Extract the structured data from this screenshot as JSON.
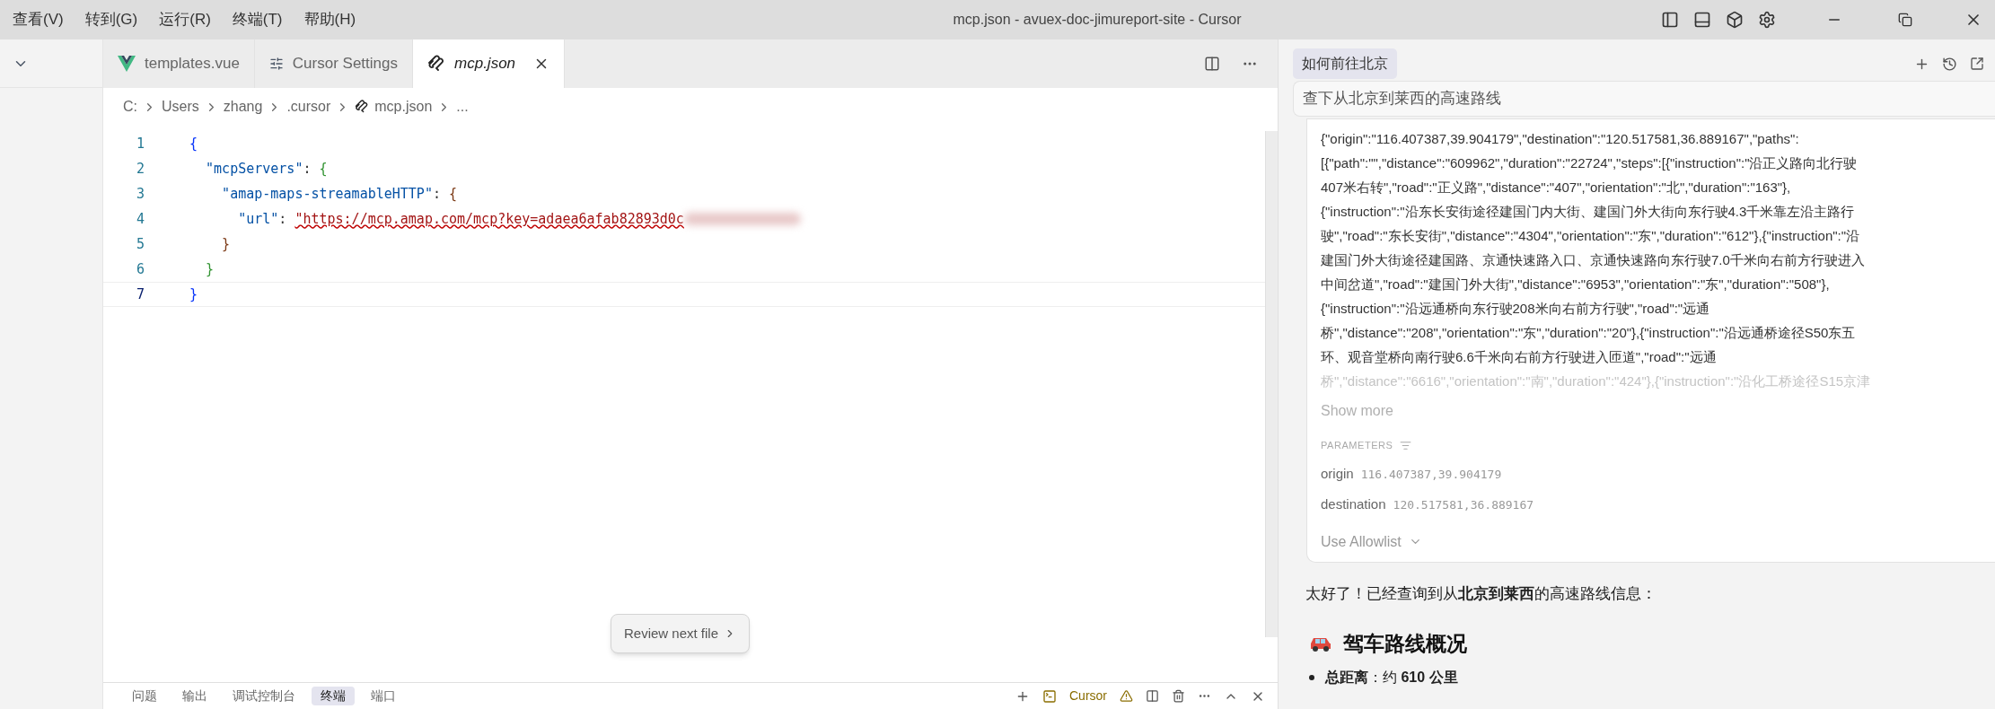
{
  "menu": [
    "查看(V)",
    "转到(G)",
    "运行(R)",
    "终端(T)",
    "帮助(H)"
  ],
  "window": {
    "title": "mcp.json - avuex-doc-jimureport-site - Cursor"
  },
  "tabs": [
    {
      "label": "templates.vue",
      "kind": "vue",
      "selected": false,
      "preview": false
    },
    {
      "label": "Cursor Settings",
      "kind": "settings",
      "selected": false,
      "preview": false
    },
    {
      "label": "mcp.json",
      "kind": "mcp",
      "selected": true,
      "preview": true
    }
  ],
  "breadcrumb": [
    "C:",
    "Users",
    "zhang",
    ".cursor",
    "mcp.json",
    "..."
  ],
  "code": [
    {
      "number": "1",
      "current": false,
      "tokens": [
        {
          "text": "{",
          "kind": "bracket",
          "color": "#0431fa"
        }
      ]
    },
    {
      "number": "2",
      "current": false,
      "tokens": [
        {
          "text": "  \"mcpServers\"",
          "kind": "key"
        },
        {
          "text": ": ",
          "kind": "punct"
        },
        {
          "text": "{",
          "kind": "bracket",
          "color": "#319331"
        }
      ]
    },
    {
      "number": "3",
      "current": false,
      "tokens": [
        {
          "text": "    \"amap-maps-streamableHTTP\"",
          "kind": "key"
        },
        {
          "text": ": ",
          "kind": "punct"
        },
        {
          "text": "{",
          "kind": "bracket",
          "color": "#7b3814"
        }
      ]
    },
    {
      "number": "4",
      "current": false,
      "tokens": [
        {
          "text": "      \"url\"",
          "kind": "key"
        },
        {
          "text": ": ",
          "kind": "punct"
        },
        {
          "text": "\"https://mcp.amap.com/mcp?key=adaea6afab82893d0c",
          "kind": "string"
        },
        {
          "kind": "redacted"
        }
      ]
    },
    {
      "number": "5",
      "current": false,
      "tokens": [
        {
          "text": "    }",
          "kind": "bracket",
          "color": "#7b3814"
        }
      ]
    },
    {
      "number": "6",
      "current": false,
      "tokens": [
        {
          "text": "  }",
          "kind": "bracket",
          "color": "#319331"
        }
      ]
    },
    {
      "number": "7",
      "current": true,
      "tokens": [
        {
          "text": "}",
          "kind": "bracket",
          "color": "#0431fa"
        }
      ]
    }
  ],
  "review_button": "Review next file",
  "panel_tabs": [
    {
      "label": "问题",
      "selected": false
    },
    {
      "label": "输出",
      "selected": false
    },
    {
      "label": "调试控制台",
      "selected": false
    },
    {
      "label": "终端",
      "selected": true
    },
    {
      "label": "端口",
      "selected": false
    }
  ],
  "terminal_name": "Cursor",
  "chat": {
    "title": "如何前往北京",
    "query": "查下从北京到莱西的高速路线",
    "result_lines": [
      {
        "text": "{\"origin\":\"116.407387,39.904179\",\"destination\":\"120.517581,36.889167\",\"paths\":",
        "faded": false
      },
      {
        "text": "[{\"path\":\"\",\"distance\":\"609962\",\"duration\":\"22724\",\"steps\":[{\"instruction\":\"沿正义路向北行驶",
        "faded": false
      },
      {
        "text": "407米右转\",\"road\":\"正义路\",\"distance\":\"407\",\"orientation\":\"北\",\"duration\":\"163\"},",
        "faded": false
      },
      {
        "text": "{\"instruction\":\"沿东长安街途径建国门内大街、建国门外大街向东行驶4.3千米靠左沿主路行",
        "faded": false
      },
      {
        "text": "驶\",\"road\":\"东长安街\",\"distance\":\"4304\",\"orientation\":\"东\",\"duration\":\"612\"},{\"instruction\":\"沿",
        "faded": false
      },
      {
        "text": "建国门外大街途径建国路、京通快速路入口、京通快速路向东行驶7.0千米向右前方行驶进入",
        "faded": false
      },
      {
        "text": "中间岔道\",\"road\":\"建国门外大街\",\"distance\":\"6953\",\"orientation\":\"东\",\"duration\":\"508\"},",
        "faded": false
      },
      {
        "text": "{\"instruction\":\"沿远通桥向东行驶208米向右前方行驶\",\"road\":\"远通",
        "faded": false
      },
      {
        "text": "桥\",\"distance\":\"208\",\"orientation\":\"东\",\"duration\":\"20\"},{\"instruction\":\"沿远通桥途径S50东五",
        "faded": false
      },
      {
        "text": "环、观音堂桥向南行驶6.6千米向右前方行驶进入匝道\",\"road\":\"远通",
        "faded": false
      },
      {
        "text": "桥\",\"distance\":\"6616\",\"orientation\":\"南\",\"duration\":\"424\"},{\"instruction\":\"沿化工桥途径S15京津",
        "faded": true
      }
    ],
    "show_more": "Show more",
    "parameters_label": "PARAMETERS",
    "parameters": [
      {
        "name": "origin",
        "value": "116.407387,39.904179"
      },
      {
        "name": "destination",
        "value": "120.517581,36.889167"
      }
    ],
    "allowlist": "Use Allowlist",
    "reply": "太好了！已经查询到从**北京到莱西**的高速路线信息：",
    "heading": "驾车路线概况",
    "bullets": [
      "**总距离**：约 **610 公里**"
    ]
  }
}
